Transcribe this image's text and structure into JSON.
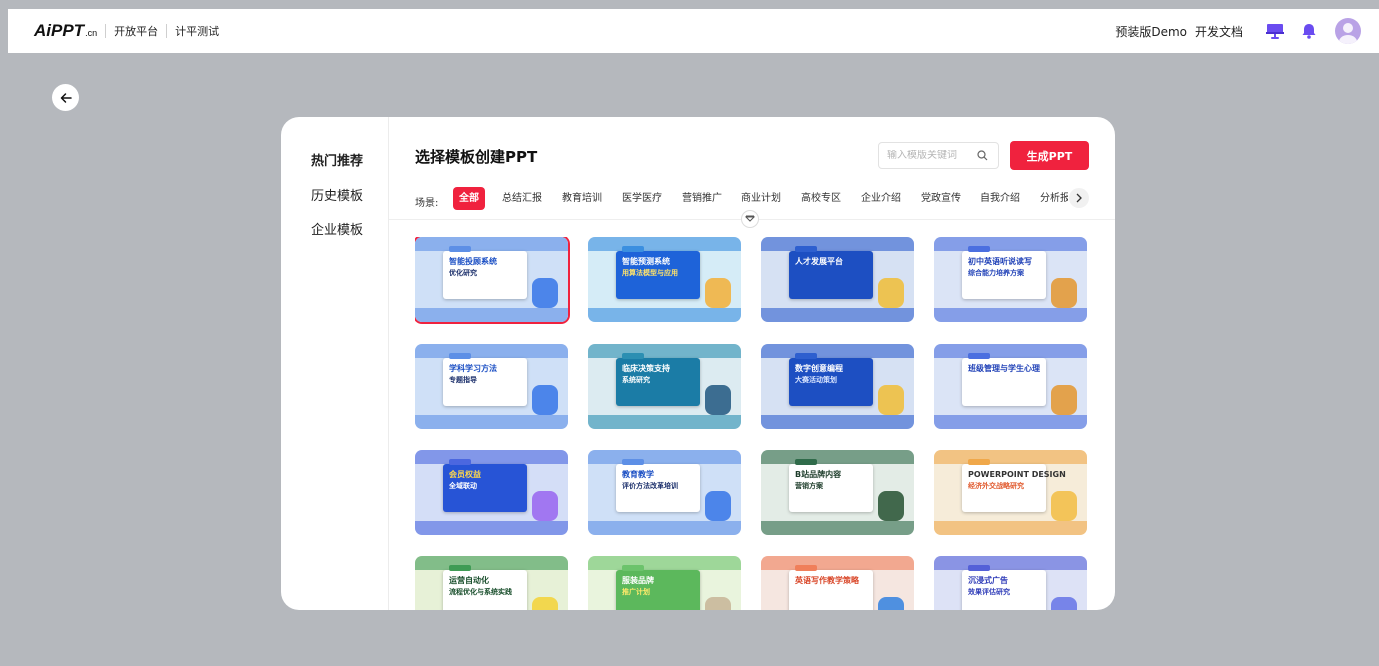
{
  "topbar": {
    "logo_main": "AiPPT",
    "logo_domain": ".cn",
    "nav_open_platform": "开放平台",
    "nav_test": "计平测试",
    "preinstall_label": "预装版Demo",
    "dev_docs_label": "开发文档",
    "icons": [
      "presentation-icon",
      "bell-icon",
      "user-avatar"
    ],
    "icon_colors": {
      "presentation": "#6a4cf0",
      "bell": "#6a4cf0",
      "avatar": "#b9a2e6"
    }
  },
  "sidebar": {
    "items": [
      {
        "label": "热门推荐",
        "active": true
      },
      {
        "label": "历史模板",
        "active": false
      },
      {
        "label": "企业模板",
        "active": false
      }
    ]
  },
  "header": {
    "title": "选择模板创建PPT",
    "search_placeholder": "输入模版关键词",
    "generate_label": "生成PPT"
  },
  "scenes": {
    "label": "场景:",
    "tabs": [
      "全部",
      "总结汇报",
      "教育培训",
      "医学医疗",
      "营销推广",
      "商业计划",
      "高校专区",
      "企业介绍",
      "党政宣传",
      "自我介绍",
      "分析报"
    ],
    "active_index": 0
  },
  "accent_color": "#f0223e",
  "templates": [
    {
      "title": "智能投顾系统",
      "subtitle": "优化研究",
      "theme": "blue",
      "selected": true
    },
    {
      "title": "智能预测系统",
      "subtitle": "用算法模型与应用",
      "theme": "cyan",
      "selected": false
    },
    {
      "title": "人才发展平台",
      "subtitle": "",
      "theme": "navy",
      "selected": false
    },
    {
      "title": "初中英语听说读写",
      "subtitle": "综合能力培养方案",
      "theme": "royal",
      "selected": false
    },
    {
      "title": "学科学习方法",
      "subtitle": "专题指导",
      "theme": "blue",
      "selected": false
    },
    {
      "title": "临床决策支持",
      "subtitle": "系统研究",
      "theme": "teal",
      "selected": false
    },
    {
      "title": "数字创意编程",
      "subtitle": "大赛活动策划",
      "theme": "navy",
      "selected": false
    },
    {
      "title": "班级管理与学生心理",
      "subtitle": "",
      "theme": "royal",
      "selected": false
    },
    {
      "title": "会员权益",
      "subtitle": "全域联动",
      "theme": "purple",
      "selected": false
    },
    {
      "title": "教育教学",
      "subtitle": "评价方法改革培训",
      "theme": "blue",
      "selected": false
    },
    {
      "title": "B站品牌内容",
      "subtitle": "营销方案",
      "theme": "green",
      "selected": false
    },
    {
      "title": "POWERPOINT DESIGN",
      "subtitle": "经济外交战略研究",
      "theme": "orange",
      "selected": false
    },
    {
      "title": "运营自动化",
      "subtitle": "流程优化与系统实践",
      "theme": "greenyellow",
      "selected": false
    },
    {
      "title": "服装品牌",
      "subtitle": "推广计划",
      "theme": "lime",
      "selected": false
    },
    {
      "title": "英语写作教学策略",
      "subtitle": "",
      "theme": "coral",
      "selected": false
    },
    {
      "title": "沉浸式广告",
      "subtitle": "效果评估研究",
      "theme": "indigo",
      "selected": false
    }
  ]
}
